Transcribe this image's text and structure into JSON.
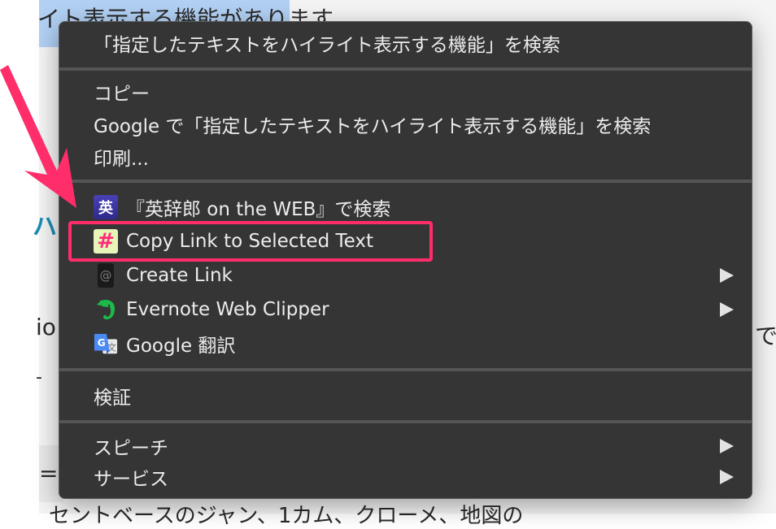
{
  "background_page": {
    "line1": "イト表示する機能があります",
    "heading_fragment": "ハ",
    "line2_fragment": "io",
    "line2_right_fragment": "で",
    "line3_fragment": "-",
    "line4_fragment": "=(",
    "line5_fragment": "セントベースのジャン、1カム、クローメ、地図の"
  },
  "context_menu": {
    "groups": [
      {
        "items": [
          {
            "label": "「指定したテキストをハイライト表示する機能」を検索"
          }
        ]
      },
      {
        "items": [
          {
            "label": "コピー"
          },
          {
            "label": "Google で「指定したテキストをハイライト表示する機能」を検索"
          },
          {
            "label": "印刷..."
          }
        ]
      },
      {
        "items": [
          {
            "label": "『英辞郎 on the WEB』で検索",
            "icon": "eijiro-icon",
            "icon_text": "英"
          },
          {
            "label": "Copy Link to Selected Text",
            "icon": "hash-icon",
            "icon_text": "#",
            "highlighted": true
          },
          {
            "label": "Create Link",
            "icon": "create-link-icon",
            "icon_text": "@",
            "submenu": true
          },
          {
            "label": "Evernote Web Clipper",
            "icon": "evernote-icon",
            "submenu": true
          },
          {
            "label": "Google 翻訳",
            "icon": "google-translate-icon",
            "icon_text": "G",
            "icon_text2": "文"
          }
        ]
      },
      {
        "items": [
          {
            "label": "検証"
          }
        ]
      },
      {
        "items": [
          {
            "label": "スピーチ",
            "submenu": true
          },
          {
            "label": "サービス",
            "submenu": true
          }
        ]
      }
    ]
  },
  "annotation": {
    "arrow_color": "#ff2d6a",
    "highlight_color": "#ff2d6a"
  },
  "colors": {
    "menu_background": "#353535",
    "menu_text": "#ececec",
    "separator": "#555555",
    "selection_highlight": "#b1d0f4"
  }
}
